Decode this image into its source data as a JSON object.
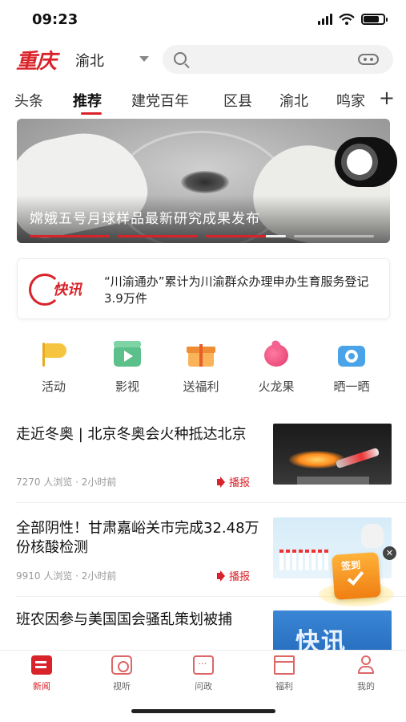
{
  "status_bar": {
    "time": "09:23"
  },
  "header": {
    "logo_text": "重庆",
    "city": "渝北",
    "search_placeholder": ""
  },
  "tabs": [
    {
      "label": "头条",
      "active": false
    },
    {
      "label": "推荐",
      "active": true
    },
    {
      "label": "建党百年",
      "active": false
    },
    {
      "label": "区县",
      "active": false
    },
    {
      "label": "渝北",
      "active": false
    },
    {
      "label": "鸣家",
      "active": false
    }
  ],
  "tab_add_label": "+",
  "banner": {
    "title": "嫦娥五号月球样品最新研究成果发布",
    "pager_count": 4,
    "pager_active": 0
  },
  "flash_news": {
    "logo_text": "快讯",
    "text": "“川渝通办”累计为川渝群众办理申办生育服务登记3.9万件"
  },
  "quick_links": [
    {
      "label": "活动",
      "icon": "flag-icon"
    },
    {
      "label": "影视",
      "icon": "film-icon"
    },
    {
      "label": "送福利",
      "icon": "gift-icon"
    },
    {
      "label": "火龙果",
      "icon": "dragonfruit-icon"
    },
    {
      "label": "晒一晒",
      "icon": "camera-icon"
    }
  ],
  "news": [
    {
      "title": "走近冬奥 | 北京冬奥会火种抵达北京",
      "meta": "7270 人浏览 · 2小时前",
      "play_label": "播报",
      "thumb": "olympic-torch"
    },
    {
      "title": "全部阴性！甘肃嘉峪关市完成32.48万份核酸检测",
      "meta": "9910 人浏览 · 2小时前",
      "play_label": "播报",
      "thumb": "covid-test"
    },
    {
      "title": "班农因参与美国国会骚乱策划被捕",
      "meta": "",
      "play_label": "",
      "thumb": "flash-news",
      "thumb_text": "快讯"
    }
  ],
  "checkin_widget": {
    "label": "签到"
  },
  "bottom_nav": [
    {
      "label": "新闻",
      "active": true
    },
    {
      "label": "视听",
      "active": false
    },
    {
      "label": "问政",
      "active": false
    },
    {
      "label": "福利",
      "active": false
    },
    {
      "label": "我的",
      "active": false
    }
  ],
  "colors": {
    "brand_red": "#d8232a",
    "text_dark": "#111111",
    "meta_gray": "#999999"
  }
}
